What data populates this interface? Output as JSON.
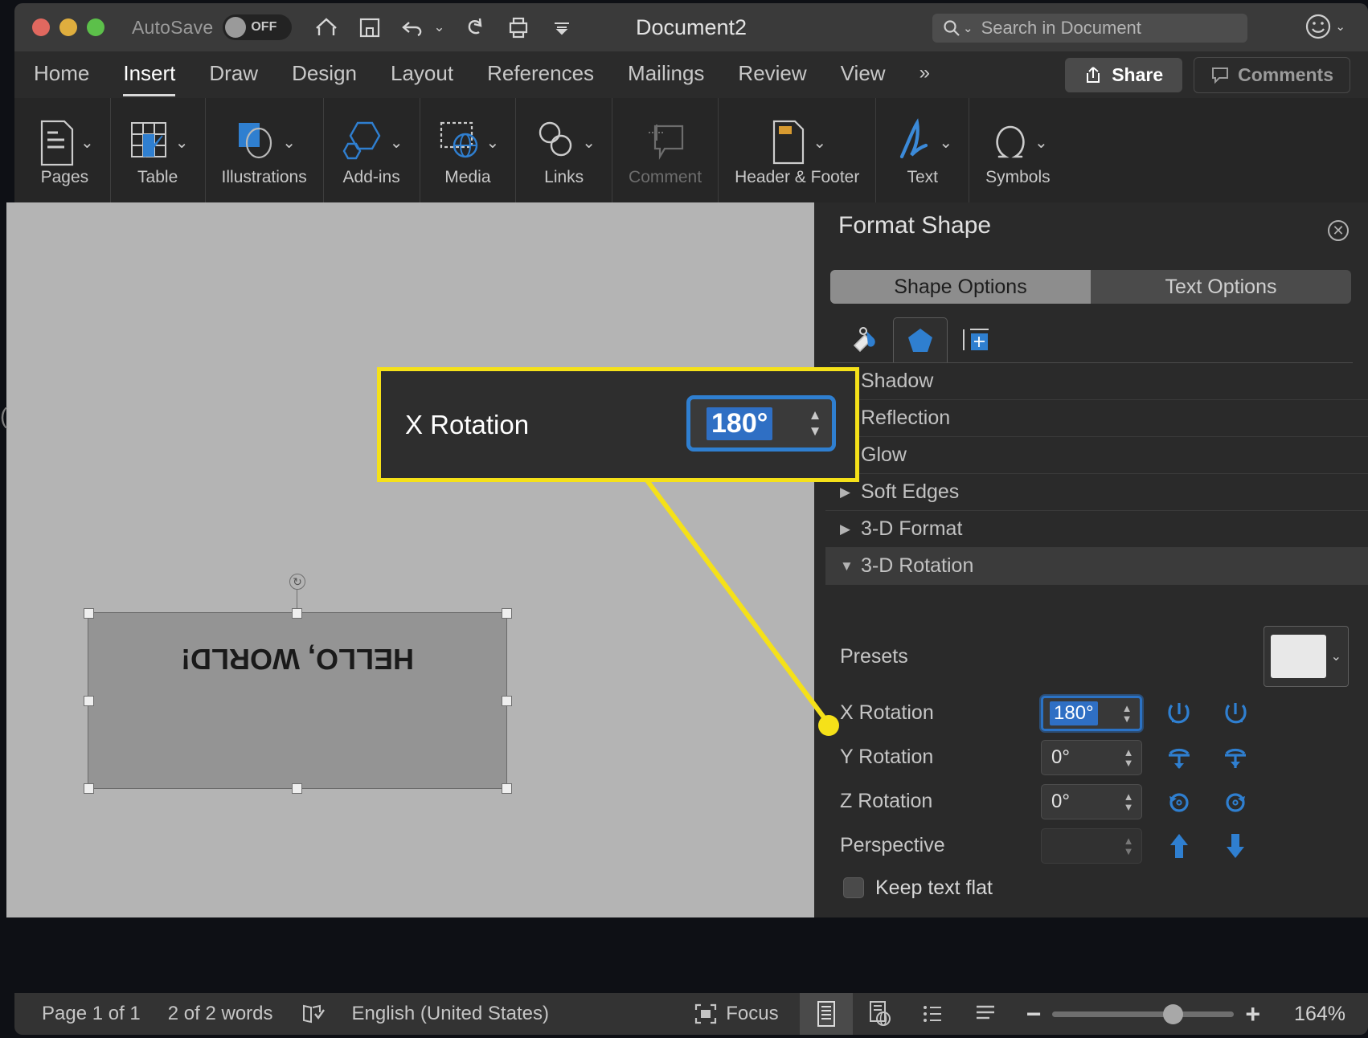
{
  "titlebar": {
    "autosave_label": "AutoSave",
    "autosave_state": "OFF",
    "document_title": "Document2",
    "icons": [
      "home-icon",
      "save-icon",
      "undo-icon",
      "redo-icon",
      "print-icon",
      "customize-toolbar-icon"
    ],
    "search_placeholder": "Search in Document"
  },
  "ribbon": {
    "tabs": [
      {
        "label": "Home",
        "active": false
      },
      {
        "label": "Insert",
        "active": true
      },
      {
        "label": "Draw",
        "active": false
      },
      {
        "label": "Design",
        "active": false
      },
      {
        "label": "Layout",
        "active": false
      },
      {
        "label": "References",
        "active": false
      },
      {
        "label": "Mailings",
        "active": false
      },
      {
        "label": "Review",
        "active": false
      },
      {
        "label": "View",
        "active": false
      }
    ],
    "overflow_label": "»",
    "share_label": "Share",
    "comments_label": "Comments",
    "groups": [
      {
        "label": "Pages",
        "icon": "page-icon",
        "disabled": false
      },
      {
        "label": "Table",
        "icon": "table-icon",
        "disabled": false
      },
      {
        "label": "Illustrations",
        "icon": "illustrations-icon",
        "disabled": false
      },
      {
        "label": "Add-ins",
        "icon": "addins-icon",
        "disabled": false
      },
      {
        "label": "Media",
        "icon": "media-icon",
        "disabled": false
      },
      {
        "label": "Links",
        "icon": "links-icon",
        "disabled": false
      },
      {
        "label": "Comment",
        "icon": "comment-icon",
        "disabled": true
      },
      {
        "label": "Header & Footer",
        "icon": "header-footer-icon",
        "disabled": false
      },
      {
        "label": "Text",
        "icon": "text-icon",
        "disabled": false
      },
      {
        "label": "Symbols",
        "icon": "symbols-icon",
        "disabled": false
      }
    ]
  },
  "document": {
    "shape_text": "HELLO, WORLD!"
  },
  "callout": {
    "label": "X Rotation",
    "value": "180°"
  },
  "panel": {
    "title": "Format Shape",
    "segments": [
      {
        "label": "Shape Options",
        "active": true
      },
      {
        "label": "Text Options",
        "active": false
      }
    ],
    "tabs": [
      {
        "name": "fill-line-icon",
        "active": false
      },
      {
        "name": "effects-icon",
        "active": true
      },
      {
        "name": "layout-properties-icon",
        "active": false
      }
    ],
    "accordion": [
      {
        "label": "Shadow",
        "open": false
      },
      {
        "label": "Reflection",
        "open": false
      },
      {
        "label": "Glow",
        "open": false
      },
      {
        "label": "Soft Edges",
        "open": false
      },
      {
        "label": "3-D Format",
        "open": false
      },
      {
        "label": "3-D Rotation",
        "open": true
      }
    ],
    "rotation": {
      "presets_label": "Presets",
      "rows": [
        {
          "label": "X Rotation",
          "value": "180°",
          "focused": true,
          "enabled": true
        },
        {
          "label": "Y Rotation",
          "value": "0°",
          "focused": false,
          "enabled": true
        },
        {
          "label": "Z Rotation",
          "value": "0°",
          "focused": false,
          "enabled": true
        },
        {
          "label": "Perspective",
          "value": "",
          "focused": false,
          "enabled": false
        }
      ],
      "keep_text_flat_label": "Keep text flat",
      "keep_text_flat_checked": false
    }
  },
  "statusbar": {
    "page_label": "Page 1 of 1",
    "words_label": "2 of 2 words",
    "proofing_icon": "proofing-icon",
    "language_label": "English (United States)",
    "focus_label": "Focus",
    "zoom_percent": "164%"
  },
  "colors": {
    "accent_blue": "#2f6fc4",
    "highlight_yellow": "#f5e119",
    "panel_bg": "#2a2a2a",
    "canvas_gray": "#b4b4b4"
  }
}
